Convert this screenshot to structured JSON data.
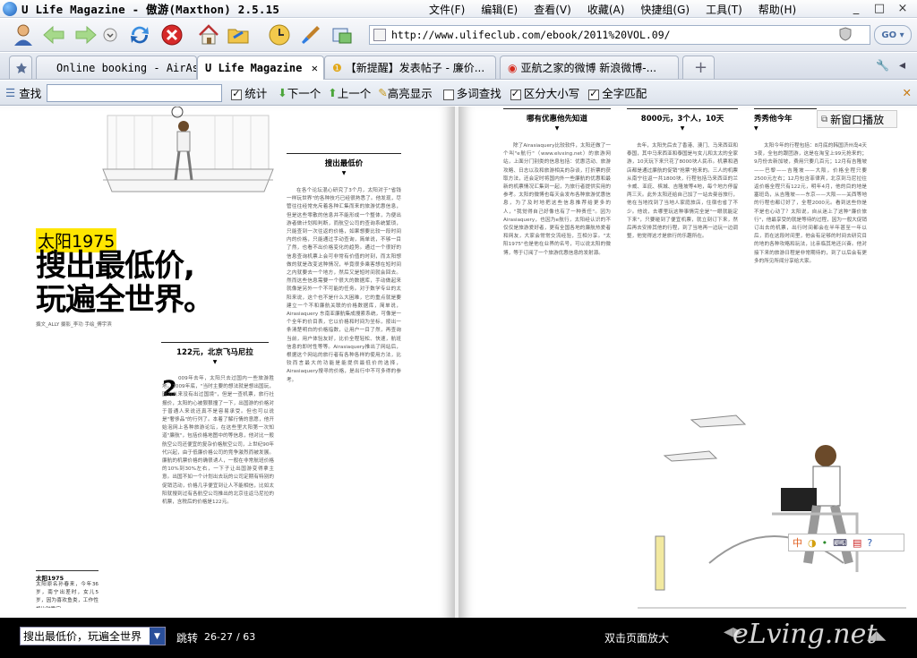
{
  "window": {
    "title": "U Life Magazine - 傲游(Maxthon) 2.5.15",
    "menus": [
      "文件(F)",
      "编辑(E)",
      "查看(V)",
      "收藏(A)",
      "快捷组(G)",
      "工具(T)",
      "帮助(H)"
    ],
    "controls": [
      "_",
      "□",
      "×"
    ]
  },
  "toolbar": {
    "url": "http://www.ulifeclub.com/ebook/2011%20VOL.09/",
    "go_label": "GO"
  },
  "tabs": [
    {
      "label": "Online booking - AirAsia"
    },
    {
      "label": "U Life Magazine",
      "active": true
    },
    {
      "label": "【新提醒】发表帖子 - 廉价..."
    },
    {
      "label": "亚航之家的微博 新浪微博-..."
    }
  ],
  "findbar": {
    "find_label": "查找",
    "count_label": "统计",
    "next_label": "下一个",
    "prev_label": "上一个",
    "highlight_label": "高亮显示",
    "multi_label": "多词查找",
    "case_label": "区分大小写",
    "whole_label": "全字匹配"
  },
  "magazine": {
    "name_tag": "太阳1975",
    "headline_1": "搜出最低价,",
    "headline_2": "玩遍全世界。",
    "credits": "撰文_ALLY 摄影_李功 手绘_傅宇滨",
    "sec_left_1": "122元，北京飞马尼拉",
    "sec_left_2": "搜出最低价",
    "sec_right_1": "哪有优惠他先知道",
    "sec_right_2": "8000元，3个人，10天",
    "sec_right_3": "秀秀他今年",
    "popout_label": "新窗口播放",
    "dropcap": "2",
    "sidebar_title": "太阳1975",
    "sidebar_text": "太阳原名孙春来，今年36岁，南宁出差时，女儿5岁，因为喜欢鱼类，工作性格比较稳定。"
  },
  "bottom": {
    "chapter_select": "搜出最低价，玩遍全世界",
    "jump_label": "跳转",
    "page_current": "26-27",
    "page_total": "/ 63",
    "zoom_hint": "双击页面放大",
    "watermark": "eLving.net"
  }
}
